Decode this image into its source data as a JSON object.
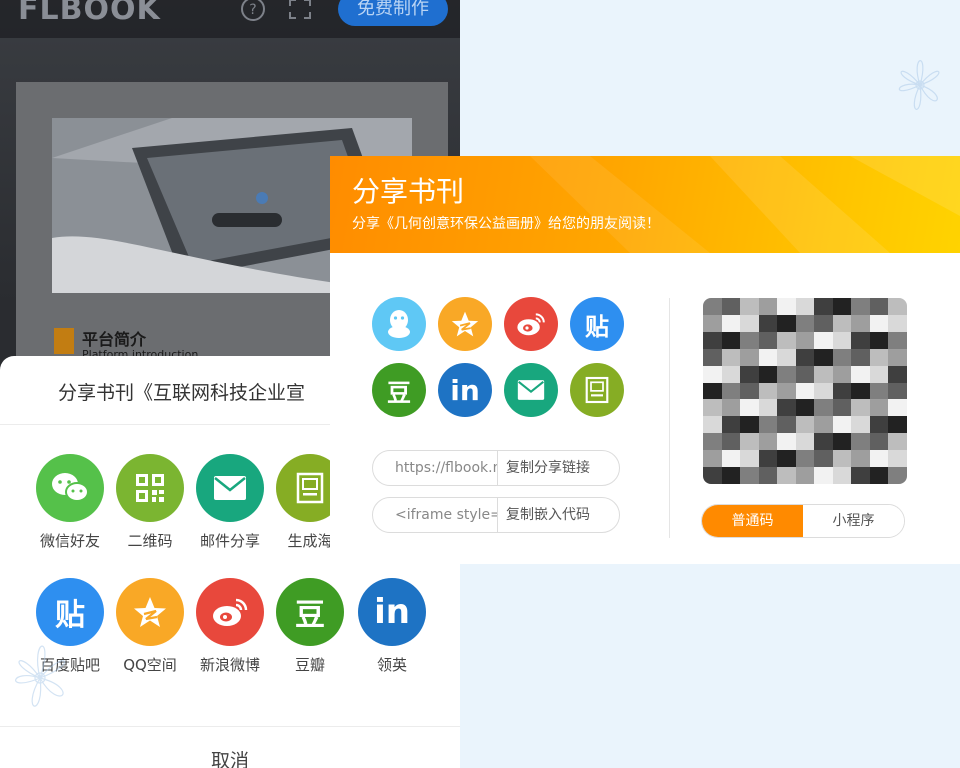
{
  "colors": {
    "wechat": "#55c14a",
    "qrcode": "#7bb531",
    "email": "#18a77e",
    "poster": "#86ad24",
    "tieba": "#2e8ff0",
    "qzone": "#f9a826",
    "weibo": "#e8483c",
    "douban": "#3f9c24",
    "linkedin": "#1e73c4",
    "qq": "#5fc8f5",
    "accent_orange": "#ff8a00",
    "brand_blue": "#1f6fd0"
  },
  "phone": {
    "logo": "FLBOOK",
    "header_icons": [
      "help-icon",
      "fullscreen-icon"
    ],
    "make_button": "免费制作",
    "intro_title": "平台简介",
    "intro_subtitle": "Platform introduction",
    "share_sheet": {
      "title": "分享书刊《互联网科技企业宣",
      "items": [
        {
          "label": "微信好友",
          "icon": "wechat-icon",
          "glyph": "◕◕"
        },
        {
          "label": "二维码",
          "icon": "qrcode-icon",
          "glyph": "▣"
        },
        {
          "label": "邮件分享",
          "icon": "mail-icon",
          "glyph": "✉"
        },
        {
          "label": "生成海",
          "icon": "poster-icon",
          "glyph": "▤"
        },
        {
          "label": "百度贴吧",
          "icon": "tieba-icon",
          "glyph": "贴"
        },
        {
          "label": "QQ空间",
          "icon": "qzone-icon",
          "glyph": "★"
        },
        {
          "label": "新浪微博",
          "icon": "weibo-icon",
          "glyph": "◉"
        },
        {
          "label": "豆瓣",
          "icon": "douban-icon",
          "glyph": "豆"
        },
        {
          "label": "领英",
          "icon": "linkedin-icon",
          "glyph": "in"
        }
      ],
      "cancel": "取消"
    }
  },
  "dialog": {
    "title": "分享书刊",
    "subtitle": "分享《几何创意环保公益画册》给您的朋友阅读！",
    "icons": [
      {
        "icon": "qq-icon",
        "glyph": "♟"
      },
      {
        "icon": "qzone-icon",
        "glyph": "★"
      },
      {
        "icon": "weibo-icon",
        "glyph": "◉"
      },
      {
        "icon": "tieba-icon",
        "glyph": "贴"
      },
      {
        "icon": "douban-icon",
        "glyph": "豆"
      },
      {
        "icon": "linkedin-icon",
        "glyph": "in"
      },
      {
        "icon": "mail-icon",
        "glyph": "✉"
      },
      {
        "icon": "poster-icon",
        "glyph": "▤"
      }
    ],
    "share_link": {
      "value": "https://flbook.m",
      "button": "复制分享链接"
    },
    "embed_code": {
      "value": "<iframe style='",
      "button": "复制嵌入代码"
    },
    "code_tabs": [
      {
        "label": "普通码",
        "active": true
      },
      {
        "label": "小程序",
        "active": false
      }
    ]
  }
}
